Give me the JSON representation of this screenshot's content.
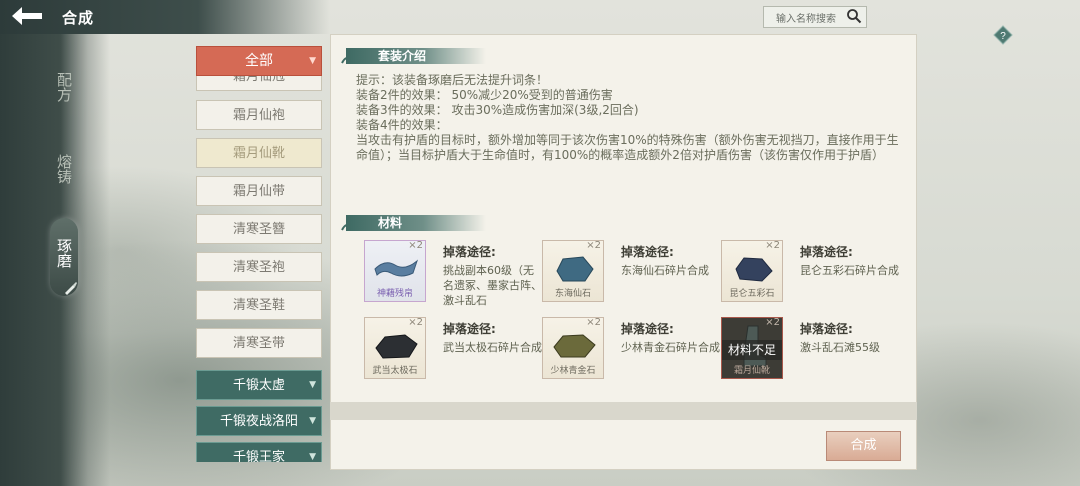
{
  "header": {
    "back_label": "←",
    "title": "合成"
  },
  "nav": {
    "items": [
      {
        "label": "配方"
      },
      {
        "label": "熔铸"
      },
      {
        "label": "琢磨"
      }
    ]
  },
  "search": {
    "placeholder": "输入名称搜索"
  },
  "categories": {
    "all_label": "全部",
    "items": [
      "霜月仙袍",
      "霜月仙靴",
      "霜月仙带",
      "清寒圣簪",
      "清寒圣袍",
      "清寒圣鞋",
      "清寒圣带"
    ],
    "partial_top": "霜月仙冠",
    "groups": [
      "千锻太虚",
      "千锻夜战洛阳",
      "千锻王家"
    ]
  },
  "set_intro": {
    "title": "套装介绍",
    "lines": [
      "提示：该装备琢磨后无法提升词条！",
      "装备2件的效果：  50%减少20%受到的普通伤害",
      "装备3件的效果：  攻击30%造成伤害加深(3级,2回合)",
      "装备4件的效果：",
      "当攻击有护盾的目标时，额外增加等同于该次伤害10%的特殊伤害（额外伤害无视挡刀，直接作用于生命值）；当目标护盾大于生命值时，有100%的概率造成额外2倍对护盾伤害（该伤害仅作用于护盾）"
    ]
  },
  "materials": {
    "title": "材料",
    "drop_label": "掉落途径:",
    "items": [
      {
        "name": "神藉残帛",
        "count": "×2",
        "drop": "挑战副本60级（无名遗冢、墨家古阵、激斗乱石"
      },
      {
        "name": "东海仙石",
        "count": "×2",
        "drop": "东海仙石碎片合成"
      },
      {
        "name": "昆仑五彩石",
        "count": "×2",
        "drop": "昆仑五彩石碎片合成"
      },
      {
        "name": "武当太极石",
        "count": "×2",
        "drop": "武当太极石碎片合成"
      },
      {
        "name": "少林青金石",
        "count": "×2",
        "drop": "少林青金石碎片合成"
      },
      {
        "name": "霜月仙靴",
        "count": "×2",
        "drop": "激斗乱石滩55级",
        "status": "材料不足"
      }
    ]
  },
  "actions": {
    "synthesize": "合成"
  }
}
